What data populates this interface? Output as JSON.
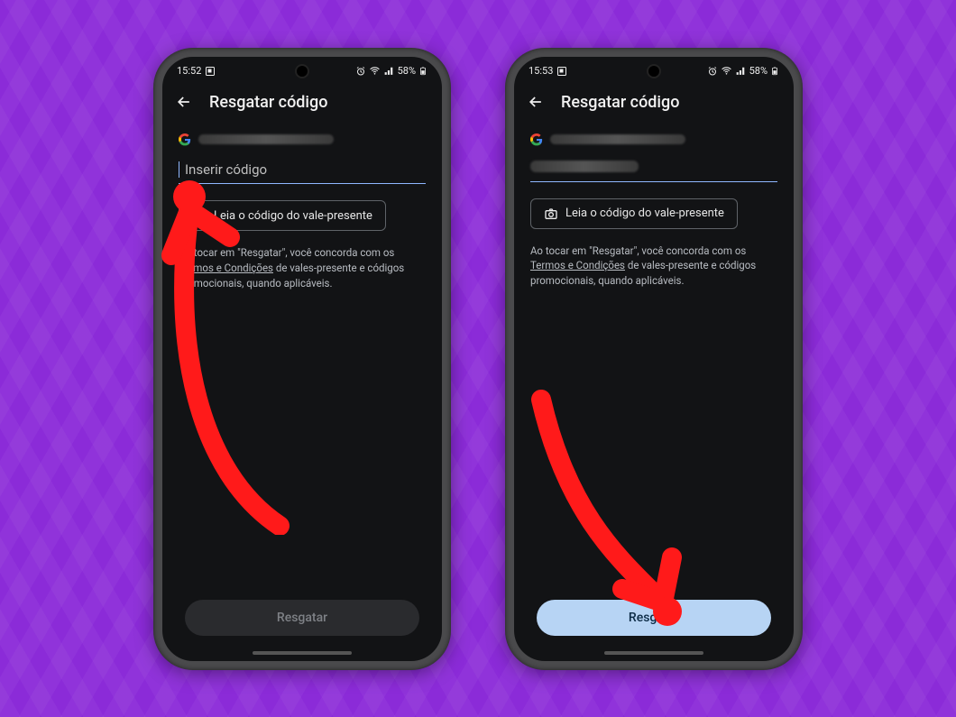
{
  "statusbar": {
    "left_time_a": "15:52",
    "left_time_b": "15:53",
    "battery_text": "58%"
  },
  "appbar": {
    "title": "Resgatar código"
  },
  "code_input": {
    "placeholder": "Inserir código"
  },
  "scan_button": {
    "label": "Leia o código do vale-presente"
  },
  "terms": {
    "prefix": "Ao tocar em \"Resgatar\", você concorda com os ",
    "link": "Termos e Condições",
    "suffix": " de vales-presente e códigos promocionais, quando aplicáveis."
  },
  "redeem": {
    "label": "Resgatar"
  }
}
